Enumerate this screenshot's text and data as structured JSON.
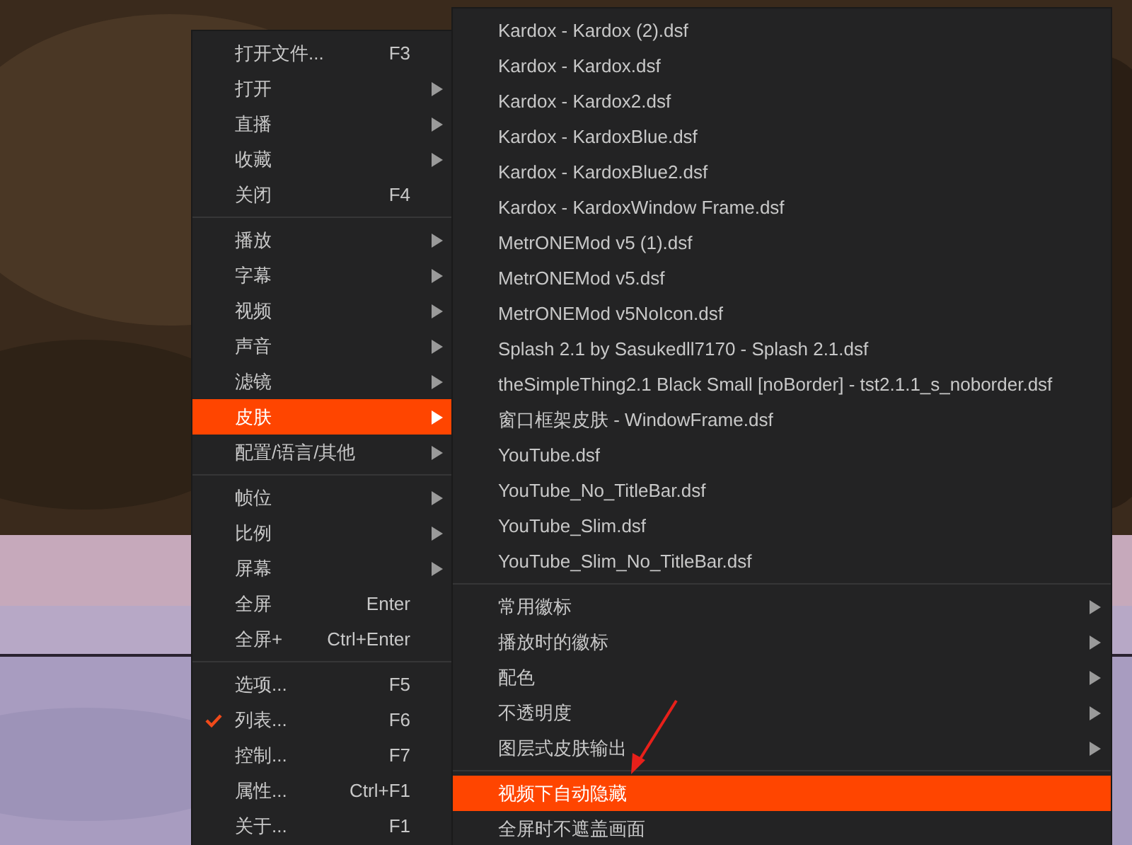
{
  "main_menu": {
    "items": [
      {
        "kind": "item",
        "label": "打开文件...",
        "shortcut": "F3",
        "submenu": false,
        "selected": false,
        "checked": false
      },
      {
        "kind": "item",
        "label": "打开",
        "submenu": true,
        "selected": false,
        "checked": false
      },
      {
        "kind": "item",
        "label": "直播",
        "submenu": true,
        "selected": false,
        "checked": false
      },
      {
        "kind": "item",
        "label": "收藏",
        "submenu": true,
        "selected": false,
        "checked": false
      },
      {
        "kind": "item",
        "label": "关闭",
        "shortcut": "F4",
        "submenu": false,
        "selected": false,
        "checked": false
      },
      {
        "kind": "separator"
      },
      {
        "kind": "item",
        "label": "播放",
        "submenu": true,
        "selected": false,
        "checked": false
      },
      {
        "kind": "item",
        "label": "字幕",
        "submenu": true,
        "selected": false,
        "checked": false
      },
      {
        "kind": "item",
        "label": "视频",
        "submenu": true,
        "selected": false,
        "checked": false
      },
      {
        "kind": "item",
        "label": "声音",
        "submenu": true,
        "selected": false,
        "checked": false
      },
      {
        "kind": "item",
        "label": "滤镜",
        "submenu": true,
        "selected": false,
        "checked": false
      },
      {
        "kind": "item",
        "label": "皮肤",
        "submenu": true,
        "selected": true,
        "checked": false
      },
      {
        "kind": "item",
        "label": "配置/语言/其他",
        "submenu": true,
        "selected": false,
        "checked": false
      },
      {
        "kind": "separator"
      },
      {
        "kind": "item",
        "label": "帧位",
        "submenu": true,
        "selected": false,
        "checked": false
      },
      {
        "kind": "item",
        "label": "比例",
        "submenu": true,
        "selected": false,
        "checked": false
      },
      {
        "kind": "item",
        "label": "屏幕",
        "submenu": true,
        "selected": false,
        "checked": false
      },
      {
        "kind": "item",
        "label": "全屏",
        "shortcut": "Enter",
        "submenu": false,
        "selected": false,
        "checked": false
      },
      {
        "kind": "item",
        "label": "全屏+",
        "shortcut": "Ctrl+Enter",
        "submenu": false,
        "selected": false,
        "checked": false
      },
      {
        "kind": "separator"
      },
      {
        "kind": "item",
        "label": "选项...",
        "shortcut": "F5",
        "submenu": false,
        "selected": false,
        "checked": false
      },
      {
        "kind": "item",
        "label": "列表...",
        "shortcut": "F6",
        "submenu": false,
        "selected": false,
        "checked": true
      },
      {
        "kind": "item",
        "label": "控制...",
        "shortcut": "F7",
        "submenu": false,
        "selected": false,
        "checked": false
      },
      {
        "kind": "item",
        "label": "属性...",
        "shortcut": "Ctrl+F1",
        "submenu": false,
        "selected": false,
        "checked": false
      },
      {
        "kind": "item",
        "label": "关于...",
        "shortcut": "F1",
        "submenu": false,
        "selected": false,
        "checked": false
      }
    ]
  },
  "skin_menu": {
    "items": [
      {
        "kind": "item",
        "label": "Kardox - Kardox (2).dsf",
        "submenu": false,
        "selected": false
      },
      {
        "kind": "item",
        "label": "Kardox - Kardox.dsf",
        "submenu": false,
        "selected": false
      },
      {
        "kind": "item",
        "label": "Kardox - Kardox2.dsf",
        "submenu": false,
        "selected": false
      },
      {
        "kind": "item",
        "label": "Kardox - KardoxBlue.dsf",
        "submenu": false,
        "selected": false
      },
      {
        "kind": "item",
        "label": "Kardox - KardoxBlue2.dsf",
        "submenu": false,
        "selected": false
      },
      {
        "kind": "item",
        "label": "Kardox - KardoxWindow Frame.dsf",
        "submenu": false,
        "selected": false
      },
      {
        "kind": "item",
        "label": "MetrONEMod v5 (1).dsf",
        "submenu": false,
        "selected": false
      },
      {
        "kind": "item",
        "label": "MetrONEMod v5.dsf",
        "submenu": false,
        "selected": false
      },
      {
        "kind": "item",
        "label": "MetrONEMod v5NoIcon.dsf",
        "submenu": false,
        "selected": false
      },
      {
        "kind": "item",
        "label": "Splash 2.1 by Sasukedll7170 - Splash 2.1.dsf",
        "submenu": false,
        "selected": false
      },
      {
        "kind": "item",
        "label": "theSimpleThing2.1 Black Small [noBorder] - tst2.1.1_s_noborder.dsf",
        "submenu": false,
        "selected": false
      },
      {
        "kind": "item",
        "label": "窗口框架皮肤 - WindowFrame.dsf",
        "submenu": false,
        "selected": false
      },
      {
        "kind": "item",
        "label": "YouTube.dsf",
        "submenu": false,
        "selected": false
      },
      {
        "kind": "item",
        "label": "YouTube_No_TitleBar.dsf",
        "submenu": false,
        "selected": false
      },
      {
        "kind": "item",
        "label": "YouTube_Slim.dsf",
        "submenu": false,
        "selected": false
      },
      {
        "kind": "item",
        "label": "YouTube_Slim_No_TitleBar.dsf",
        "submenu": false,
        "selected": false
      },
      {
        "kind": "separator"
      },
      {
        "kind": "item",
        "label": "常用徽标",
        "submenu": true,
        "selected": false
      },
      {
        "kind": "item",
        "label": "播放时的徽标",
        "submenu": true,
        "selected": false
      },
      {
        "kind": "item",
        "label": "配色",
        "submenu": true,
        "selected": false
      },
      {
        "kind": "item",
        "label": "不透明度",
        "submenu": true,
        "selected": false
      },
      {
        "kind": "item",
        "label": "图层式皮肤输出",
        "submenu": true,
        "selected": false
      },
      {
        "kind": "separator"
      },
      {
        "kind": "item",
        "label": "视频下自动隐藏",
        "submenu": false,
        "selected": true
      },
      {
        "kind": "item",
        "label": "全屏时不遮盖画面",
        "submenu": false,
        "selected": false
      }
    ]
  }
}
